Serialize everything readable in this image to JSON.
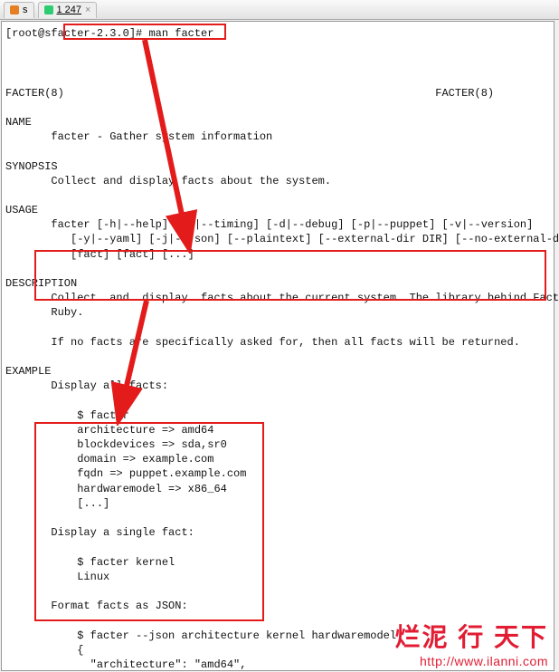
{
  "tabs": [
    {
      "icon": "orange",
      "label": "s"
    },
    {
      "icon": "green",
      "label": "1 247"
    }
  ],
  "prompt": {
    "prefix": "[root@s",
    "boxed": " facter-2.3.0]# man facter"
  },
  "man": {
    "header_left": "FACTER(8)",
    "header_right": "FACTER(8)",
    "name_hdr": "NAME",
    "name_body": "facter - Gather system information",
    "synopsis_hdr": "SYNOPSIS",
    "synopsis_body": "Collect and display facts about the system.",
    "usage_hdr": "USAGE",
    "usage_line1": "facter [-h|--help] [-t|--timing] [-d|--debug] [-p|--puppet] [-v|--version]",
    "usage_line2": "[-y|--yaml] [-j|--json] [--plaintext] [--external-dir DIR] [--no-external-dir]",
    "usage_line3": "[fact] [fact] [...]",
    "description_hdr": "DESCRIPTION",
    "description_p1": "Collect  and  display  facts about the current system. The library behind Facter",
    "description_p2": "Ruby.",
    "description_p3": "If no facts are specifically asked for, then all facts will be returned.",
    "example_hdr": "EXAMPLE",
    "ex_display_all": "Display all facts:",
    "ex_facter_cmd": "$ facter",
    "ex_arch": "architecture => amd64",
    "ex_block": "blockdevices => sda,sr0",
    "ex_domain": "domain => example.com",
    "ex_fqdn": "fqdn => puppet.example.com",
    "ex_hw": "hardwaremodel => x86_64",
    "ex_ellipsis": "[...]",
    "ex_single_hdr": "Display a single fact:",
    "ex_kernel_cmd": "$ facter kernel",
    "ex_kernel_out": "Linux",
    "ex_json_hdr": "Format facts as JSON:",
    "ex_json_cmd": "$ facter --json architecture kernel hardwaremodel",
    "ex_json_brace": "{",
    "ex_json_line": "  \"architecture\": \"amd64\","
  },
  "watermark": {
    "line1": "烂泥 行 天下",
    "line2": "http://www.ilanni.com"
  }
}
